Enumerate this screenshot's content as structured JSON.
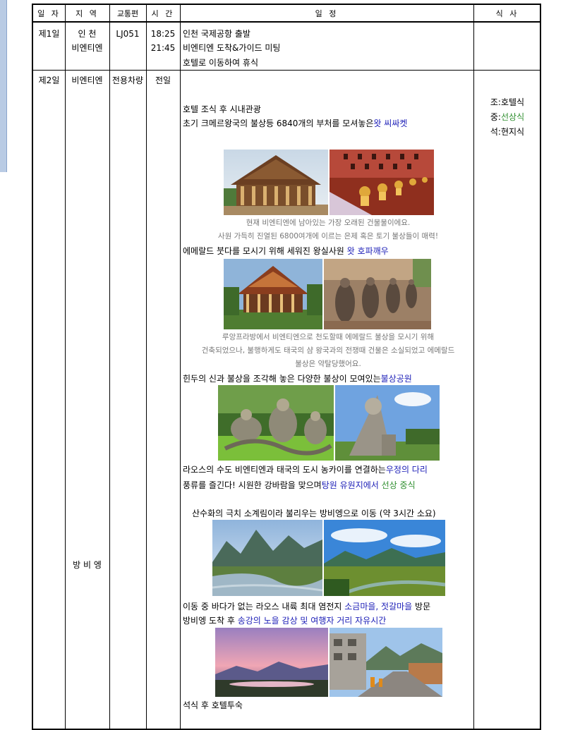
{
  "header": {
    "date": "일 자",
    "region": "지 역",
    "transport": "교통편",
    "time": "시 간",
    "schedule": "일 정",
    "meal": "식 사"
  },
  "day1": {
    "label": "제1일",
    "region_1": "인 천",
    "region_2": "비엔티엔",
    "flight": "LJ051",
    "time_1": "18:25",
    "time_2": "21:45",
    "line_1": "인천 국제공항 출발",
    "line_2": "비엔티엔 도착&가이드 미팅",
    "line_3": "호텔로 이동하여 휴식"
  },
  "day2": {
    "label": "제2일",
    "region_1": "비엔티엔",
    "region_2": "방 비 엥",
    "transport": "전용차량",
    "time": "전일",
    "meals": {
      "breakfast": "조:호텔식",
      "lunch_prefix": "중:",
      "lunch": "선상식",
      "dinner": "석:현지식"
    },
    "s1": "호텔 조식 후 시내관광",
    "s2_text": "초기 크메르왕국의 불상등 6840개의 부처를 모셔놓은",
    "s2_place": "왓 씨싸켓",
    "cap1_1": "현재 비엔티엔에 남아있는 가장 오래된 건물물이에요.",
    "cap1_2": "사원 가득히 진열된 6800여개에 이르는 은제 혹은 토기 불상들이 매력!",
    "s3_text": "에메랄드 붓다를 모시기 위해 세워진 왕실사원",
    "s3_place": "왓 호파깨우",
    "cap2_1": "루앙프라방에서 비엔티엔으로 천도할때 에메랄드 불상을 모시기 위해",
    "cap2_2": "건축되었으나, 불행하게도 태국의 샴 왕국과의 전쟁때 건물은 소실되었고 에메랄드",
    "cap2_3": "불상은 약탈당했어요.",
    "s4_text": "힌두의 신과 불상을 조각해 놓은 다양한 불상이 모여있는",
    "s4_place": "불상공원",
    "s5_text": "라오스의 수도 비엔티엔과 태국의 도시 농카이를 연결하는",
    "s5_place": "우정의 다리",
    "s6_a": "풍류를 즐긴다! 시원한 강바람을 맞으며",
    "s6_b": "탕원 유원지에서",
    "s6_c": "선상 중식",
    "s7": "산수화의 극치 소계림이라 불리우는 방비엥으로 이동 (약 3시간 소요)",
    "s8_a": "이동 중 바다가 없는 라오스 내륙 최대 염전지",
    "s8_b": "소금마을, 젓갈마을",
    "s8_c": "방문",
    "s9_a": "방비엥 도착 후",
    "s9_b": "송강의 노을 감상 및 여행자 거리 자유시간",
    "s10": "석식 후 호텔투숙"
  },
  "colors": {
    "link_blue": "#1f21b8",
    "meal_green": "#2f8f2f",
    "caption_gray": "#777777",
    "sidebar_blue": "#b9cbe4"
  }
}
